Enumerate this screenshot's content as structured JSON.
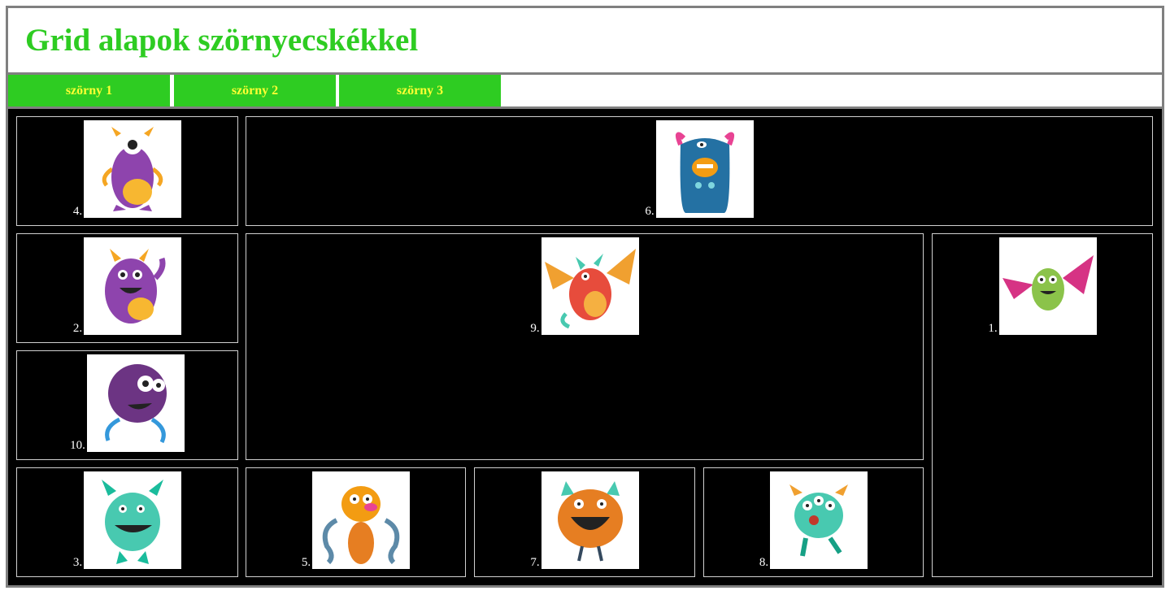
{
  "title": "Grid alapok szörnyecskékkel",
  "nav": [
    {
      "label": "szörny 1"
    },
    {
      "label": "szörny 2"
    },
    {
      "label": "szörny 3"
    }
  ],
  "cells": [
    {
      "number": "4.",
      "monster": "purple-cyclops-monster"
    },
    {
      "number": "6.",
      "monster": "blue-furry-monster"
    },
    {
      "number": "2.",
      "monster": "purple-horned-monster"
    },
    {
      "number": "9.",
      "monster": "red-dragon-monster"
    },
    {
      "number": "1.",
      "monster": "green-bat-monster"
    },
    {
      "number": "10.",
      "monster": "purple-fuzzy-monster"
    },
    {
      "number": "3.",
      "monster": "teal-horned-monster"
    },
    {
      "number": "5.",
      "monster": "orange-tentacle-monster"
    },
    {
      "number": "7.",
      "monster": "orange-furry-monster"
    },
    {
      "number": "8.",
      "monster": "teal-three-eyed-monster"
    }
  ],
  "colors": {
    "accent": "#2ecc22",
    "nav_text": "#ffff33",
    "grid_bg": "#000000",
    "frame_border": "#808080"
  }
}
